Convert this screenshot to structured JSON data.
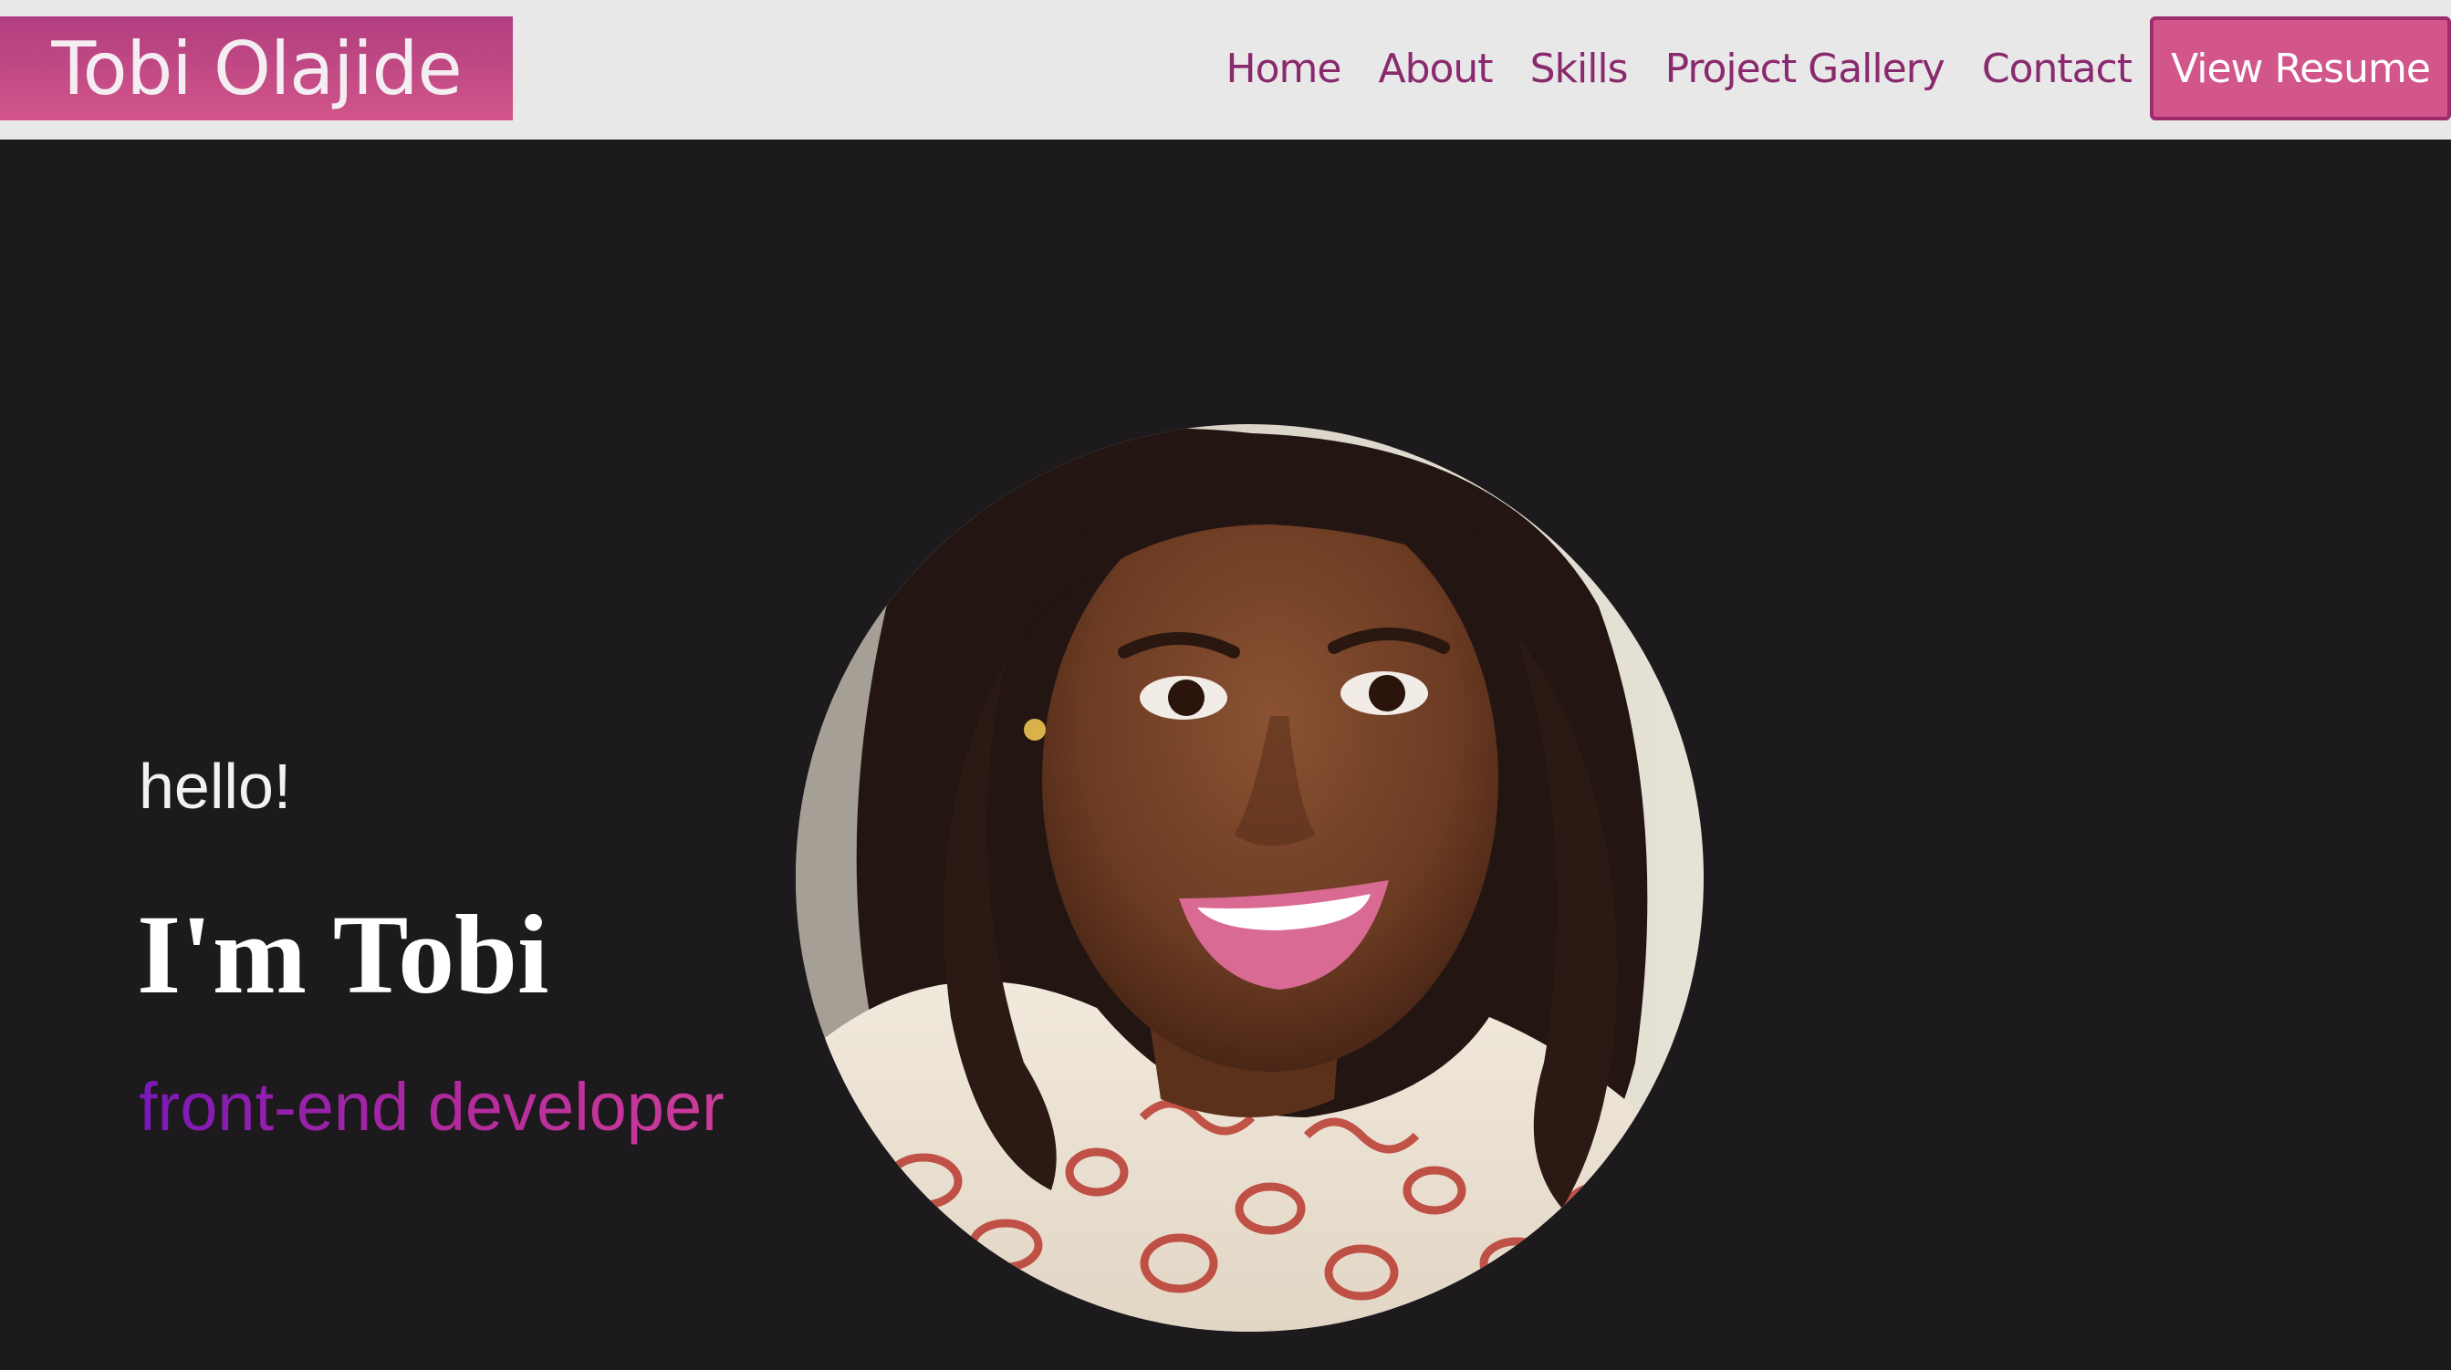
{
  "brand": {
    "name": "Tobi Olajide"
  },
  "nav": {
    "links": [
      "Home",
      "About",
      "Skills",
      "Project Gallery",
      "Contact"
    ],
    "resume_label": "View Resume"
  },
  "hero": {
    "greeting": "hello!",
    "headline": "I'm Tobi",
    "role": "front-end developer"
  },
  "portrait": {
    "icon": "profile-photo"
  },
  "colors": {
    "navbar_bg": "#e8e8e8",
    "brand_bg": "#c64a86",
    "link": "#8a2a6e",
    "resume_bg": "#d2568a",
    "hero_bg": "#1c1a1d",
    "role_gradient_start": "#7a18b8",
    "role_gradient_end": "#cf3d9a"
  }
}
